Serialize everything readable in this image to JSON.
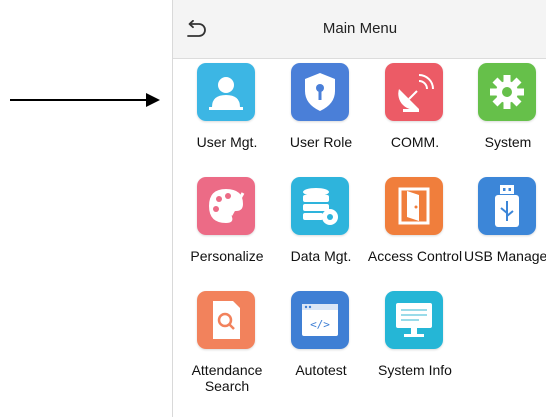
{
  "header": {
    "title": "Main Menu"
  },
  "menu": {
    "items": [
      {
        "label": "User Mgt.",
        "icon": "user-icon",
        "color": "#3cb6e4"
      },
      {
        "label": "User Role",
        "icon": "shield-key-icon",
        "color": "#4a7fd8"
      },
      {
        "label": "COMM.",
        "icon": "satellite-dish-icon",
        "color": "#ec5b66"
      },
      {
        "label": "System",
        "icon": "gear-icon",
        "color": "#66c04a"
      },
      {
        "label": "Personalize",
        "icon": "palette-icon",
        "color": "#ec6b86"
      },
      {
        "label": "Data Mgt.",
        "icon": "database-gear-icon",
        "color": "#2eb4dc"
      },
      {
        "label": "Access Control",
        "icon": "door-icon",
        "color": "#f07e3c"
      },
      {
        "label": "USB Manager",
        "icon": "usb-drive-icon",
        "color": "#3c86d8"
      },
      {
        "label": "Attendance Search",
        "icon": "document-search-icon",
        "color": "#f2825c"
      },
      {
        "label": "Autotest",
        "icon": "code-window-icon",
        "color": "#3f7fd4"
      },
      {
        "label": "System Info",
        "icon": "monitor-icon",
        "color": "#25b6d6"
      }
    ]
  }
}
